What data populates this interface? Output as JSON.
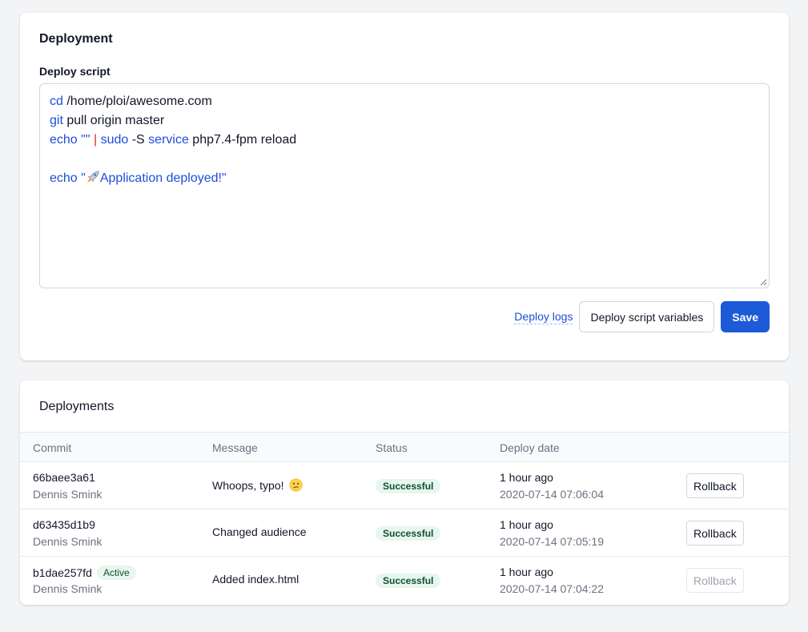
{
  "deployment": {
    "title": "Deployment",
    "script_label": "Deploy script",
    "script_lines": [
      [
        {
          "t": "kw",
          "v": "cd"
        },
        {
          "t": "plain",
          "v": " /home/ploi/awesome.com"
        }
      ],
      [
        {
          "t": "kw",
          "v": "git"
        },
        {
          "t": "plain",
          "v": " pull origin master"
        }
      ],
      [
        {
          "t": "kw",
          "v": "echo"
        },
        {
          "t": "plain",
          "v": " "
        },
        {
          "t": "str",
          "v": "\"\""
        },
        {
          "t": "plain",
          "v": " "
        },
        {
          "t": "pipe",
          "v": "|"
        },
        {
          "t": "plain",
          "v": " "
        },
        {
          "t": "kw",
          "v": "sudo"
        },
        {
          "t": "plain",
          "v": " -S "
        },
        {
          "t": "kw",
          "v": "service"
        },
        {
          "t": "plain",
          "v": " php7.4-fpm reload"
        }
      ],
      [],
      [
        {
          "t": "kw",
          "v": "echo"
        },
        {
          "t": "plain",
          "v": " "
        },
        {
          "t": "str",
          "v": "\""
        },
        {
          "t": "rocket",
          "v": ""
        },
        {
          "t": "str",
          "v": "Application deployed!\""
        }
      ]
    ],
    "actions": {
      "logs_label": "Deploy logs",
      "variables_label": "Deploy script variables",
      "save_label": "Save"
    }
  },
  "deployments": {
    "title": "Deployments",
    "columns": {
      "commit": "Commit",
      "message": "Message",
      "status": "Status",
      "date": "Deploy date"
    },
    "rows": [
      {
        "commit": "66baee3a61",
        "author": "Dennis Smink",
        "active": false,
        "message": "Whoops, typo!",
        "emoji": "confused-face-icon",
        "status": "Successful",
        "relative": "1 hour ago",
        "datetime": "2020-07-14 07:06:04",
        "rollback_label": "Rollback",
        "rollback_disabled": false
      },
      {
        "commit": "d63435d1b9",
        "author": "Dennis Smink",
        "active": false,
        "message": "Changed audience",
        "emoji": "",
        "status": "Successful",
        "relative": "1 hour ago",
        "datetime": "2020-07-14 07:05:19",
        "rollback_label": "Rollback",
        "rollback_disabled": false
      },
      {
        "commit": "b1dae257fd",
        "author": "Dennis Smink",
        "active": true,
        "active_label": "Active",
        "message": "Added index.html",
        "emoji": "",
        "status": "Successful",
        "relative": "1 hour ago",
        "datetime": "2020-07-14 07:04:22",
        "rollback_label": "Rollback",
        "rollback_disabled": true
      }
    ]
  },
  "colors": {
    "primary": "#1d5ad8",
    "keyword": "#1d4ed8",
    "pipe": "#dc2626",
    "success_bg": "#e7f6ee",
    "success_text": "#0f5132"
  }
}
